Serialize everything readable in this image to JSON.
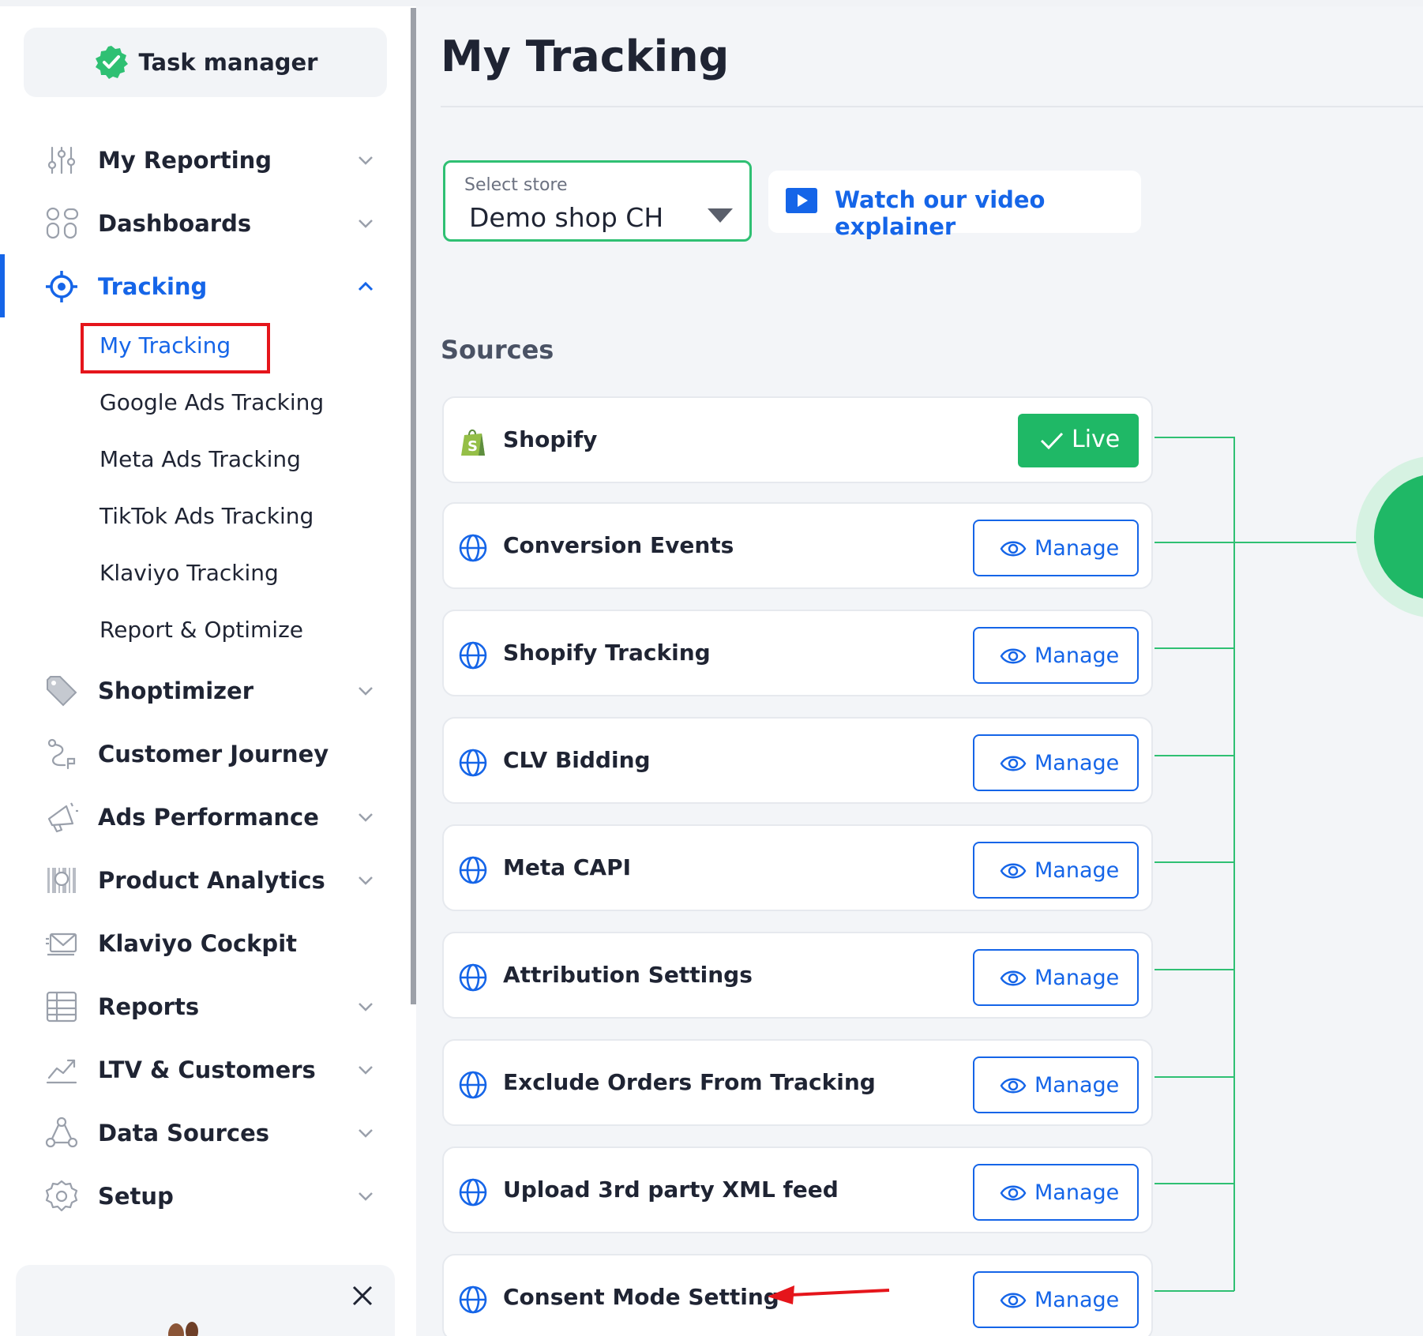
{
  "sidebar": {
    "task_manager": "Task manager",
    "nav": [
      {
        "label": "My Reporting",
        "icon": "sliders-icon"
      },
      {
        "label": "Dashboards",
        "icon": "dashboard-grid-icon"
      },
      {
        "label": "Tracking",
        "icon": "crosshair-icon"
      },
      {
        "label": "Shoptimizer",
        "icon": "tag-icon"
      },
      {
        "label": "Customer Journey",
        "icon": "route-icon"
      },
      {
        "label": "Ads Performance",
        "icon": "megaphone-icon"
      },
      {
        "label": "Product Analytics",
        "icon": "barcode-icon"
      },
      {
        "label": "Klaviyo Cockpit",
        "icon": "mail-icon"
      },
      {
        "label": "Reports",
        "icon": "table-icon"
      },
      {
        "label": "LTV & Customers",
        "icon": "trend-icon"
      },
      {
        "label": "Data Sources",
        "icon": "network-icon"
      },
      {
        "label": "Setup",
        "icon": "gear-icon"
      }
    ],
    "tracking_sub": [
      "My Tracking",
      "Google Ads Tracking",
      "Meta Ads Tracking",
      "TikTok Ads Tracking",
      "Klaviyo Tracking",
      "Report & Optimize"
    ]
  },
  "main": {
    "title": "My Tracking",
    "store": {
      "label": "Select store",
      "value": "Demo shop CH"
    },
    "video_label": "Watch our video explainer",
    "sources_title": "Sources",
    "sources": [
      {
        "label": "Shopify",
        "action": "Live"
      },
      {
        "label": "Conversion Events",
        "action": "Manage"
      },
      {
        "label": "Shopify Tracking",
        "action": "Manage"
      },
      {
        "label": "CLV Bidding",
        "action": "Manage"
      },
      {
        "label": "Meta CAPI",
        "action": "Manage"
      },
      {
        "label": "Attribution Settings",
        "action": "Manage"
      },
      {
        "label": "Exclude Orders From Tracking",
        "action": "Manage"
      },
      {
        "label": "Upload 3rd party XML feed",
        "action": "Manage"
      },
      {
        "label": "Consent Mode Setting",
        "action": "Manage"
      }
    ]
  },
  "colors": {
    "accent_blue": "#1565e8",
    "live_green": "#1fb866",
    "connector_green": "#2fc073",
    "highlight_red": "#e5151b"
  }
}
